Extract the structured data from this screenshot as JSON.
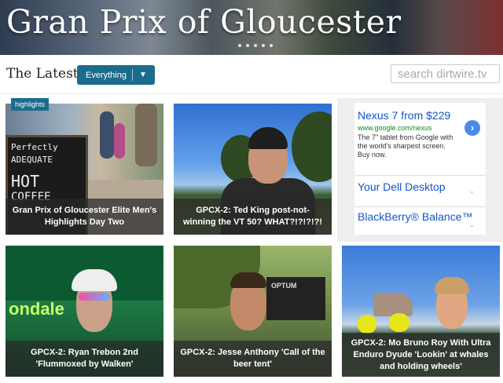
{
  "banner": {
    "title": "Gran Prix of Gloucester"
  },
  "filter": {
    "label": "The Latest:",
    "dropdown_value": "Everything",
    "dropdown_arrow": "▼",
    "search_placeholder": "search dirtwire.tv"
  },
  "badge": "highlights",
  "cards": [
    {
      "caption": "Gran Prix of Gloucester Elite Men's Highlights Day Two"
    },
    {
      "caption": "GPCX-2: Ted King post-not-winning the VT 50? WHAT?!?!?!?!"
    },
    {
      "caption": "GPCX-2: Ryan Trebon 2nd 'Flummoxed by Walken'"
    },
    {
      "caption": "GPCX-2: Jesse Anthony 'Call of the beer tent'"
    },
    {
      "caption": "GPCX-2: Mo Bruno Roy With Ultra Enduro Dyude 'Lookin' at whales and holding wheels'"
    }
  ],
  "image_text": {
    "chalk_line1": "Perfectly",
    "chalk_line2": "ADEQUATE",
    "chalk_line3": "HOT",
    "chalk_line4": "COFFEE",
    "tent_logo": "ondale",
    "sign_text": "OPTUM"
  },
  "ad": {
    "headline": "Nexus 7 from $229",
    "url": "www.google.com/nexus",
    "description": "The 7\" tablet from Google with the world's sharpest screen. Buy now.",
    "go_icon": "›",
    "links": [
      {
        "label": "Your Dell Desktop",
        "chevron": "⌄"
      },
      {
        "label": "BlackBerry® Balance™",
        "chevron": "⌄"
      }
    ]
  },
  "colors": {
    "accent": "#1b6c8c",
    "caption_bg": "rgba(40,40,40,0.72)"
  }
}
